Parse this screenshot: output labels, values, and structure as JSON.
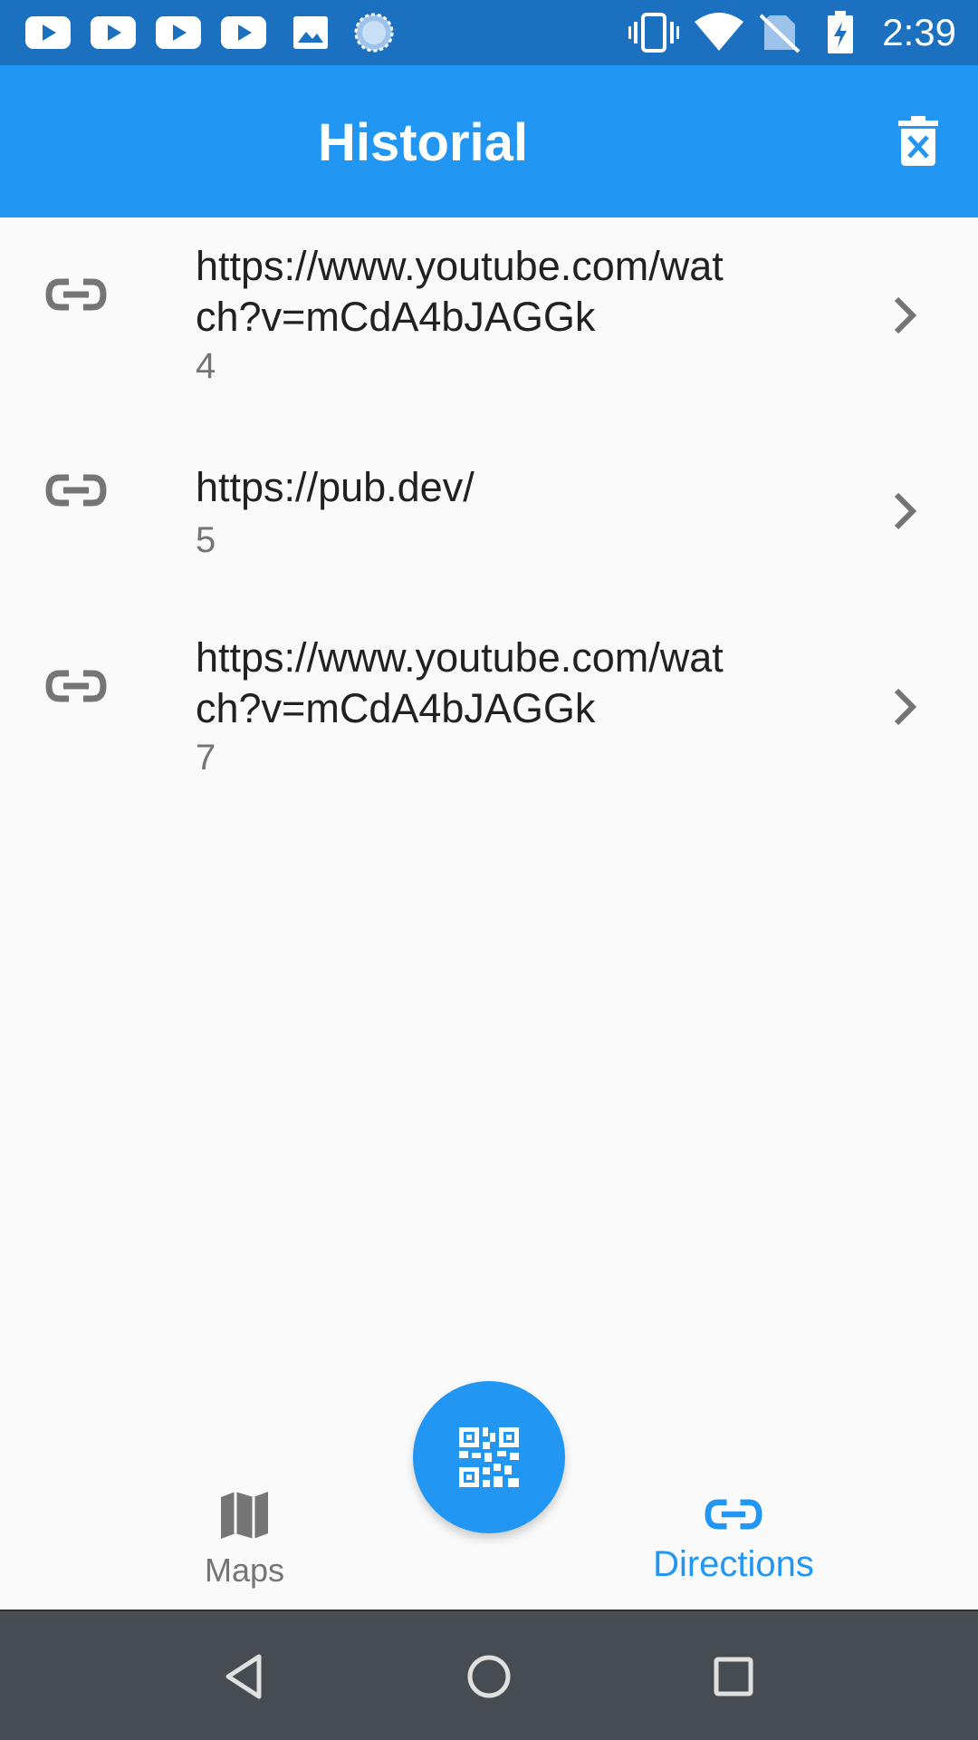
{
  "status_bar": {
    "time": "2:39",
    "notification_icons": [
      "youtube-icon",
      "youtube-icon",
      "youtube-icon",
      "youtube-icon",
      "image-icon",
      "sync-circle-icon"
    ],
    "system_icons": [
      "vibrate-icon",
      "wifi-icon",
      "no-sim-icon",
      "battery-charging-icon"
    ]
  },
  "app_bar": {
    "title": "Historial",
    "action_icon": "delete-forever-icon",
    "color": "#2196f3"
  },
  "history": [
    {
      "url": "https://www.youtube.com/watch?v=mCdA4bJAGGk",
      "id": "4",
      "icon": "link-icon"
    },
    {
      "url": "https://pub.dev/",
      "id": "5",
      "icon": "link-icon"
    },
    {
      "url": "https://www.youtube.com/watch?v=mCdA4bJAGGk",
      "id": "7",
      "icon": "link-icon"
    }
  ],
  "bottom_nav": {
    "items": [
      {
        "label": "Maps",
        "icon": "map-icon",
        "selected": false
      },
      {
        "label": "Directions",
        "icon": "link-icon",
        "selected": true
      }
    ],
    "active_color": "#2196f3",
    "inactive_color": "#757575"
  },
  "fab": {
    "icon": "qr-code-icon"
  },
  "system_nav": [
    "back-icon",
    "home-icon",
    "recents-icon"
  ]
}
